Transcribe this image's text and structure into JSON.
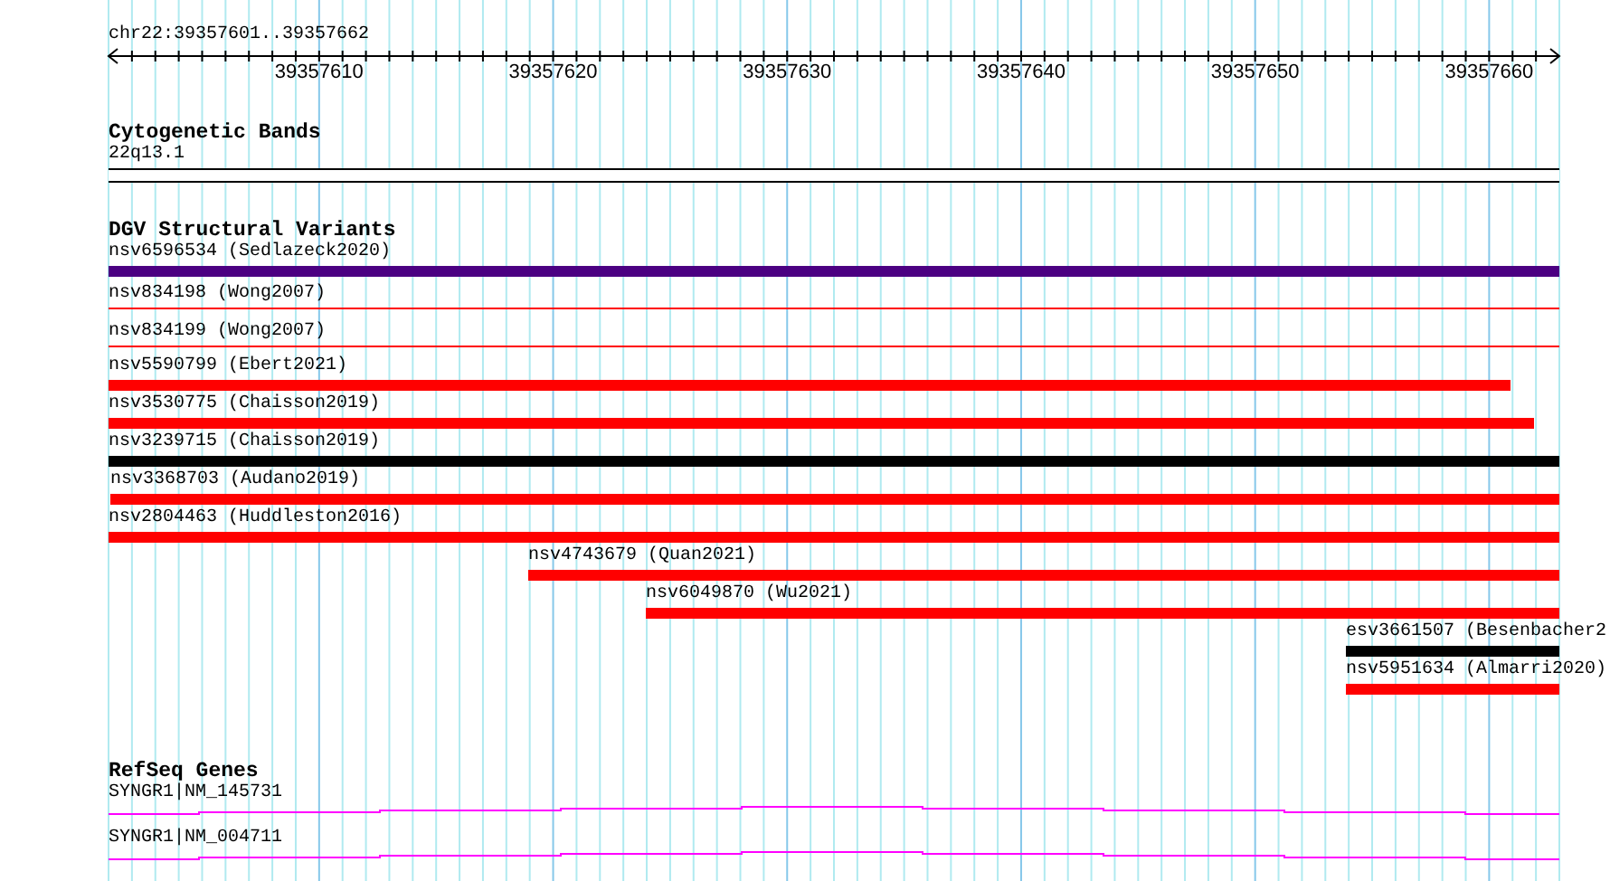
{
  "location": "chr22:39357601..39357662",
  "ruler": {
    "ticks": [
      "39357610",
      "39357620",
      "39357630",
      "39357640",
      "39357650",
      "39357660"
    ]
  },
  "tracks": [
    {
      "kind": "bands",
      "title": "Cytogenetic Bands",
      "features": [
        {
          "label": "22q13.1"
        }
      ]
    },
    {
      "kind": "variants",
      "title": "DGV Structural Variants",
      "features": [
        {
          "label": "nsv6596534 (Sedlazeck2020)",
          "kind": "bar",
          "color": "#4b0082"
        },
        {
          "label": "nsv834198 (Wong2007)",
          "kind": "line",
          "color": "#ff0000"
        },
        {
          "label": "nsv834199 (Wong2007)",
          "kind": "line",
          "color": "#ff0000"
        },
        {
          "label": "nsv5590799 (Ebert2021)",
          "kind": "bar",
          "color": "#ff0000"
        },
        {
          "label": "nsv3530775 (Chaisson2019)",
          "kind": "bar",
          "color": "#ff0000"
        },
        {
          "label": "nsv3239715 (Chaisson2019)",
          "kind": "bar",
          "color": "#000000"
        },
        {
          "label": "nsv3368703 (Audano2019)",
          "kind": "bar",
          "color": "#ff0000"
        },
        {
          "label": "nsv2804463 (Huddleston2016)",
          "kind": "bar",
          "color": "#ff0000"
        },
        {
          "label": "nsv4743679 (Quan2021)",
          "kind": "bar",
          "color": "#ff0000"
        },
        {
          "label": "nsv6049870 (Wu2021)",
          "kind": "bar",
          "color": "#ff0000"
        },
        {
          "label": "esv3661507 (Besenbacher2",
          "kind": "bar",
          "color": "#000000"
        },
        {
          "label": "nsv5951634 (Almarri2020)",
          "kind": "bar",
          "color": "#ff0000"
        }
      ]
    },
    {
      "kind": "genes",
      "title": "RefSeq Genes",
      "features": [
        {
          "label": "SYNGR1|NM_145731"
        },
        {
          "label": "SYNGR1|NM_004711"
        }
      ]
    }
  ]
}
